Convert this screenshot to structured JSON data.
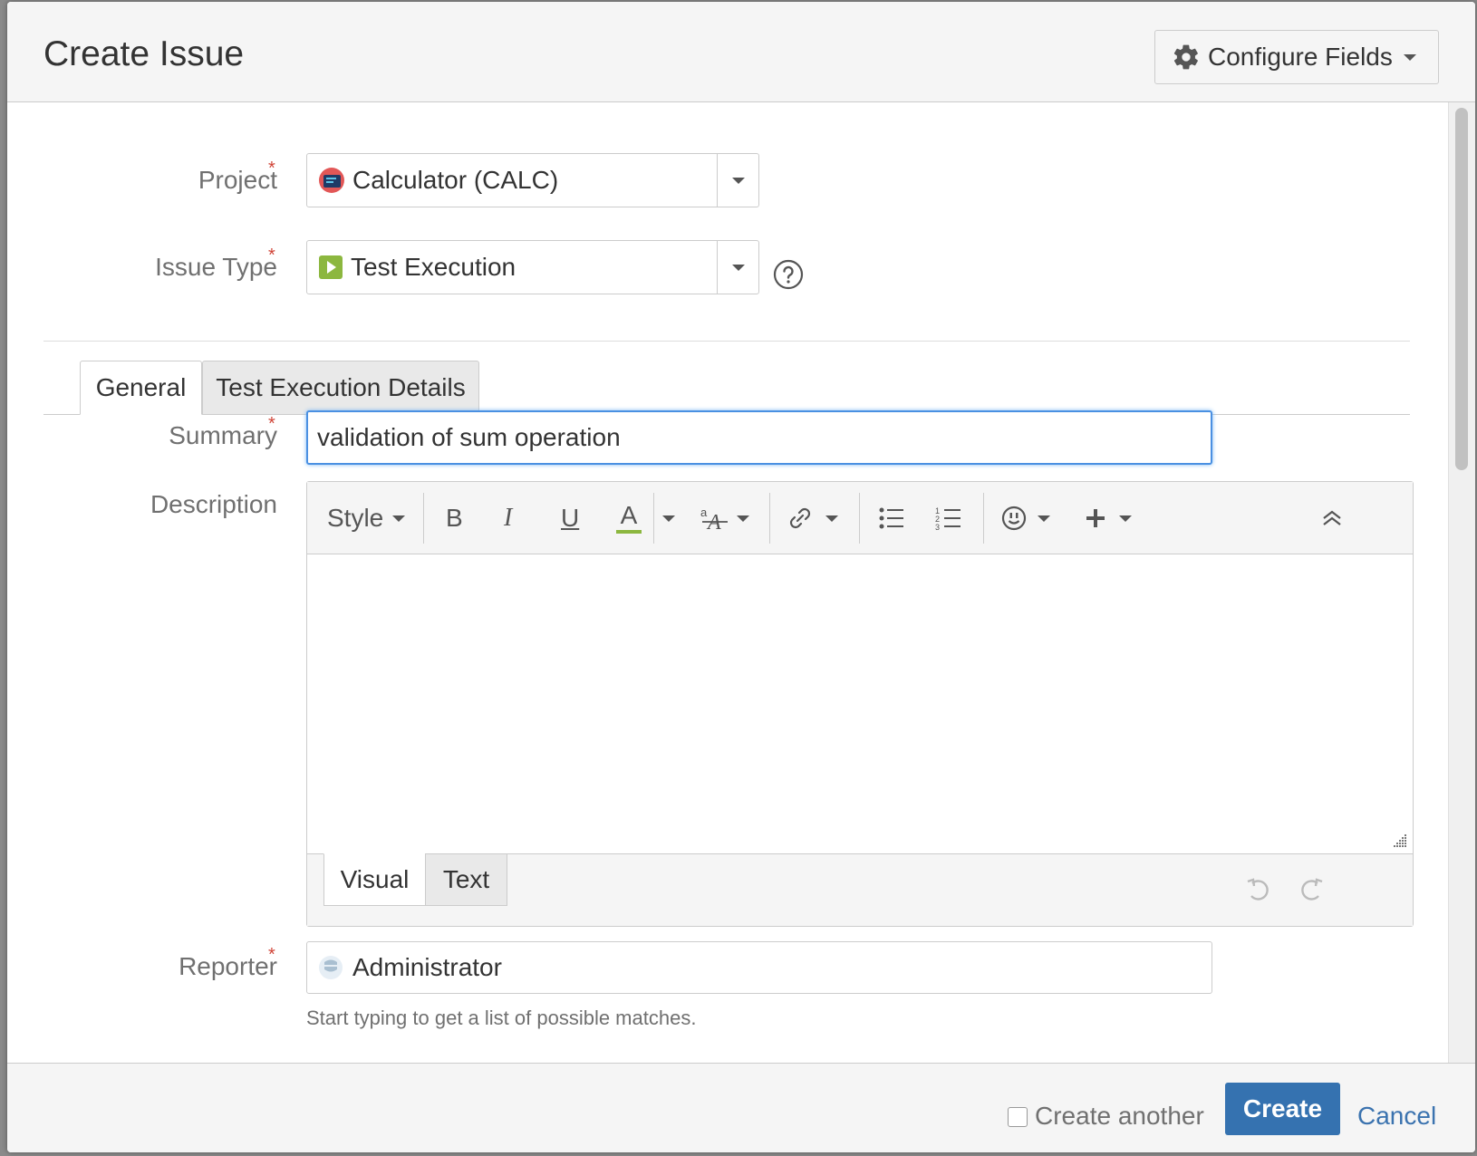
{
  "header": {
    "title": "Create Issue",
    "configure_label": "Configure Fields"
  },
  "fields": {
    "project": {
      "label": "Project",
      "value": "Calculator (CALC)"
    },
    "issue_type": {
      "label": "Issue Type",
      "value": "Test Execution"
    },
    "summary": {
      "label": "Summary",
      "value": "validation of sum operation"
    },
    "description": {
      "label": "Description"
    },
    "reporter": {
      "label": "Reporter",
      "value": "Administrator",
      "hint": "Start typing to get a list of possible matches."
    }
  },
  "required_mark": "*",
  "tabs": [
    {
      "label": "General"
    },
    {
      "label": "Test Execution Details"
    }
  ],
  "editor": {
    "style_label": "Style",
    "bold": "B",
    "italic": "I",
    "underline": "U",
    "color": "A",
    "modes": [
      {
        "label": "Visual"
      },
      {
        "label": "Text"
      }
    ]
  },
  "footer": {
    "create_another_label": "Create another",
    "create_label": "Create",
    "cancel_label": "Cancel"
  },
  "colors": {
    "accent": "#3572b0",
    "required": "#d04437",
    "focus": "#4a90e2",
    "text_color_bar": "#8cb73f"
  },
  "icons": [
    "gear-icon",
    "chevron-down-icon",
    "project-icon",
    "test-execution-icon",
    "help-icon",
    "link-icon",
    "bullet-list-icon",
    "numbered-list-icon",
    "emoticon-icon",
    "plus-icon",
    "collapse-icon",
    "undo-icon",
    "redo-icon",
    "user-avatar-icon"
  ]
}
